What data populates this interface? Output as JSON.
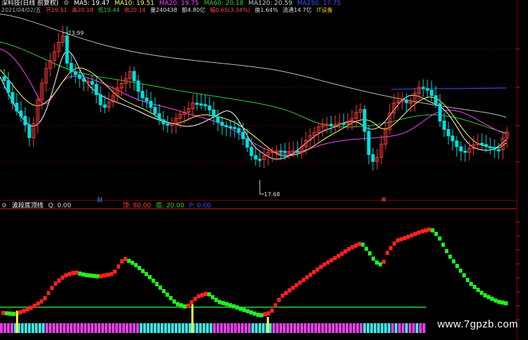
{
  "top_legend": {
    "title": "深科技(日线 前复权)",
    "items": [
      {
        "label": "MA5: 19.47",
        "color": "#ffffff"
      },
      {
        "label": "MA10: 19.51",
        "color": "#ffff66"
      },
      {
        "label": "MA20: 19.75",
        "color": "#ff44ff"
      },
      {
        "label": "MA60: 20.18",
        "color": "#33cc33"
      },
      {
        "label": "MA120: 20.59",
        "color": "#bbbbbb"
      },
      {
        "label": "MA250: 17.75",
        "color": "#3355ff"
      }
    ]
  },
  "info_line": [
    {
      "label": "2021/04/02/五",
      "color": "#aaaaaa"
    },
    {
      "label": "开19.51",
      "color": "#ff4444"
    },
    {
      "label": "高20.18",
      "color": "#ff4444"
    },
    {
      "label": "低19.44",
      "color": "#33cc33"
    },
    {
      "label": "收20.14",
      "color": "#ff4444"
    },
    {
      "label": "量240438",
      "color": "#dddddd"
    },
    {
      "label": "额4.80亿",
      "color": "#dddddd"
    },
    {
      "label": "幅0.65(3.34%)",
      "color": "#ff4444"
    },
    {
      "label": "换1.64%",
      "color": "#dddddd"
    },
    {
      "label": "流通14.7亿",
      "color": "#dddddd"
    },
    {
      "label": "IT设备",
      "color": "#ffcc00"
    }
  ],
  "annotations": {
    "high": "23.99",
    "low": "17.68"
  },
  "markers": {
    "fin_left": "财",
    "fin_right": "⊞"
  },
  "lower_legend": {
    "title": "波段底顶线",
    "items": [
      {
        "label": "Q: 0.00",
        "color": "#dddddd"
      },
      {
        "label": "顶: 80.00",
        "color": "#ff4444"
      },
      {
        "label": "底: 20.00",
        "color": "#33cc33"
      },
      {
        "label": "P: 0.00",
        "color": "#3355ff"
      }
    ]
  },
  "watermark": "www.7gpzb.com",
  "colors": {
    "up": "#ff3b3b",
    "down": "#00e0e0",
    "osc_up": "#ff2020",
    "osc_down": "#22ee22",
    "bar_magenta": "#e040e0",
    "bar_cyan": "#40e0e0",
    "baseline": "#22dd22",
    "marker": "#ffff33"
  }
}
